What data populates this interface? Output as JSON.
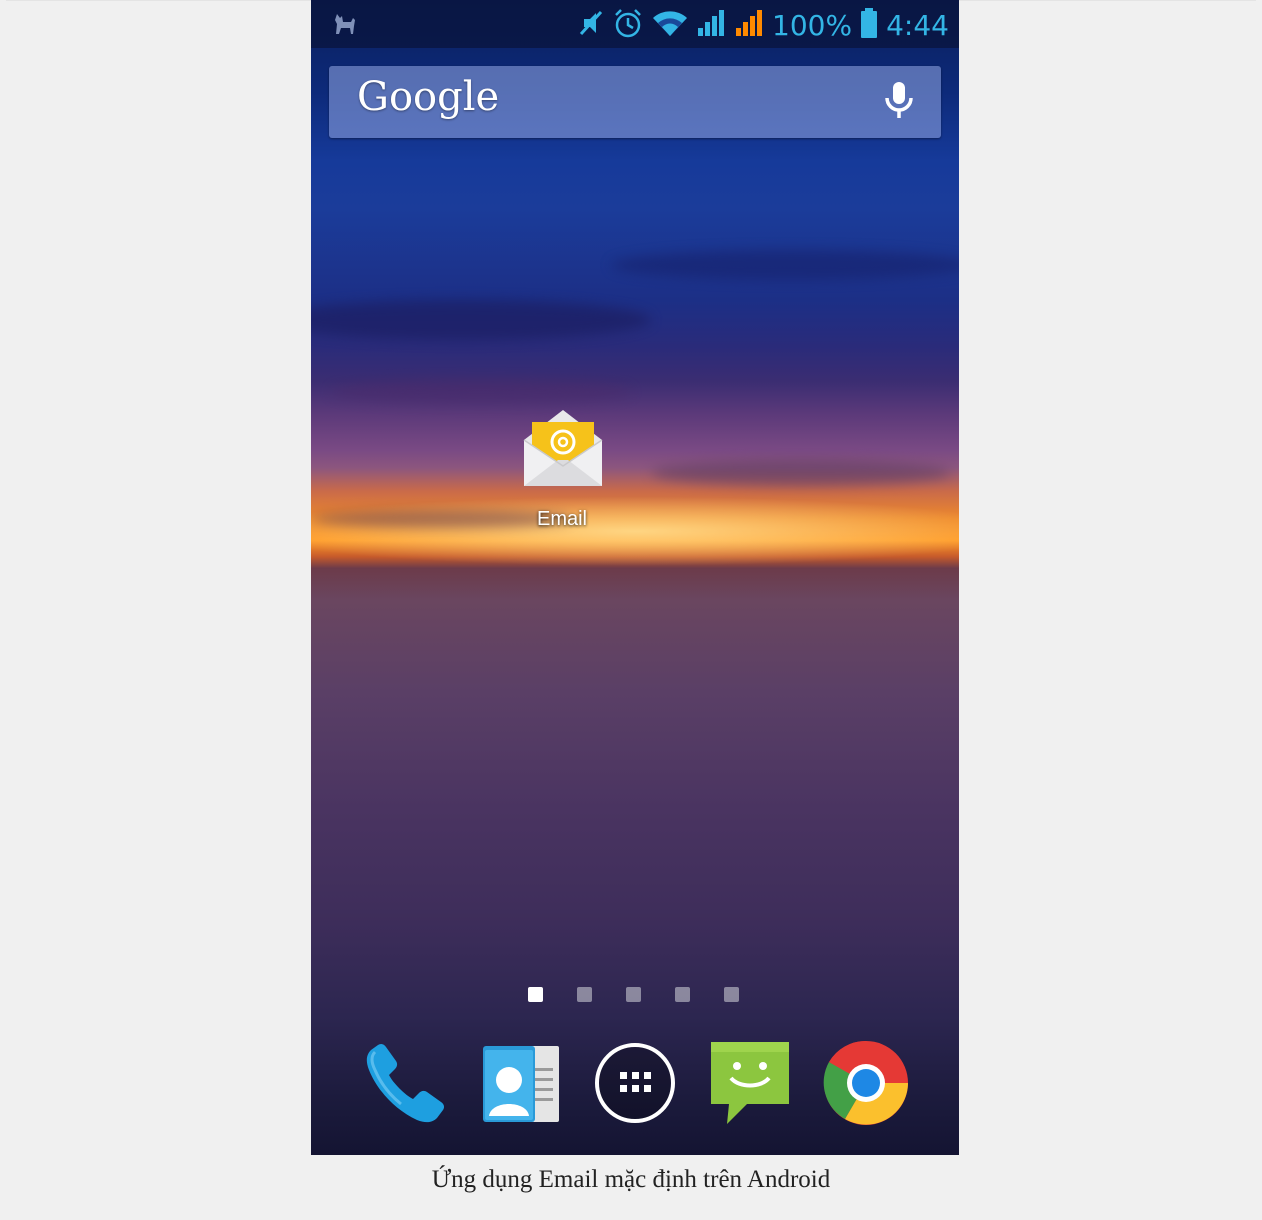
{
  "status_bar": {
    "battery_percent": "100%",
    "time": "4:44",
    "icons": [
      "notification-cat-icon",
      "mute-icon",
      "alarm-icon",
      "wifi-icon",
      "signal-sim1-icon",
      "signal-sim2-icon",
      "battery-icon"
    ]
  },
  "search_widget": {
    "logo_text": "Google",
    "voice_icon": "mic-icon"
  },
  "home_apps": [
    {
      "label": "Email",
      "icon": "email-envelope-icon"
    }
  ],
  "page_indicator": {
    "pages": 5,
    "current": 1
  },
  "dock": [
    {
      "name": "Phone",
      "icon": "phone-icon"
    },
    {
      "name": "Contacts",
      "icon": "contacts-icon"
    },
    {
      "name": "All apps",
      "icon": "app-drawer-icon"
    },
    {
      "name": "Messaging",
      "icon": "messaging-icon"
    },
    {
      "name": "Chrome",
      "icon": "chrome-icon"
    }
  ],
  "caption": "Ứng dụng Email mặc định trên Android",
  "colors": {
    "status_accent": "#33b5e5",
    "signal_sim2": "#ff8a00",
    "email_yellow": "#f6c21a",
    "messaging_green": "#8cc63f",
    "phone_blue": "#1e9fe0"
  }
}
